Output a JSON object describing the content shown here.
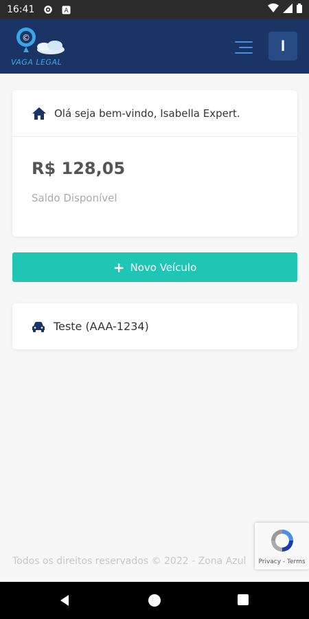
{
  "status_bar": {
    "time": "16:41"
  },
  "header": {
    "logo_text": "VAGA LEGAL",
    "avatar_initial": "I"
  },
  "welcome": {
    "greeting": "Olá seja bem-vindo, Isabella Expert."
  },
  "balance": {
    "amount": "R$ 128,05",
    "label": "Saldo Disponível"
  },
  "actions": {
    "new_vehicle": "Novo Veículo"
  },
  "vehicles": [
    {
      "label": "Teste (AAA-1234)"
    }
  ],
  "footer": {
    "text": "Todos os direitos reservados © 2022 - Zona Azul"
  },
  "recaptcha": {
    "terms": "Privacy - Terms"
  },
  "colors": {
    "header": "#1b3466",
    "accent": "#1fc6b6",
    "icon": "#1b3466"
  }
}
